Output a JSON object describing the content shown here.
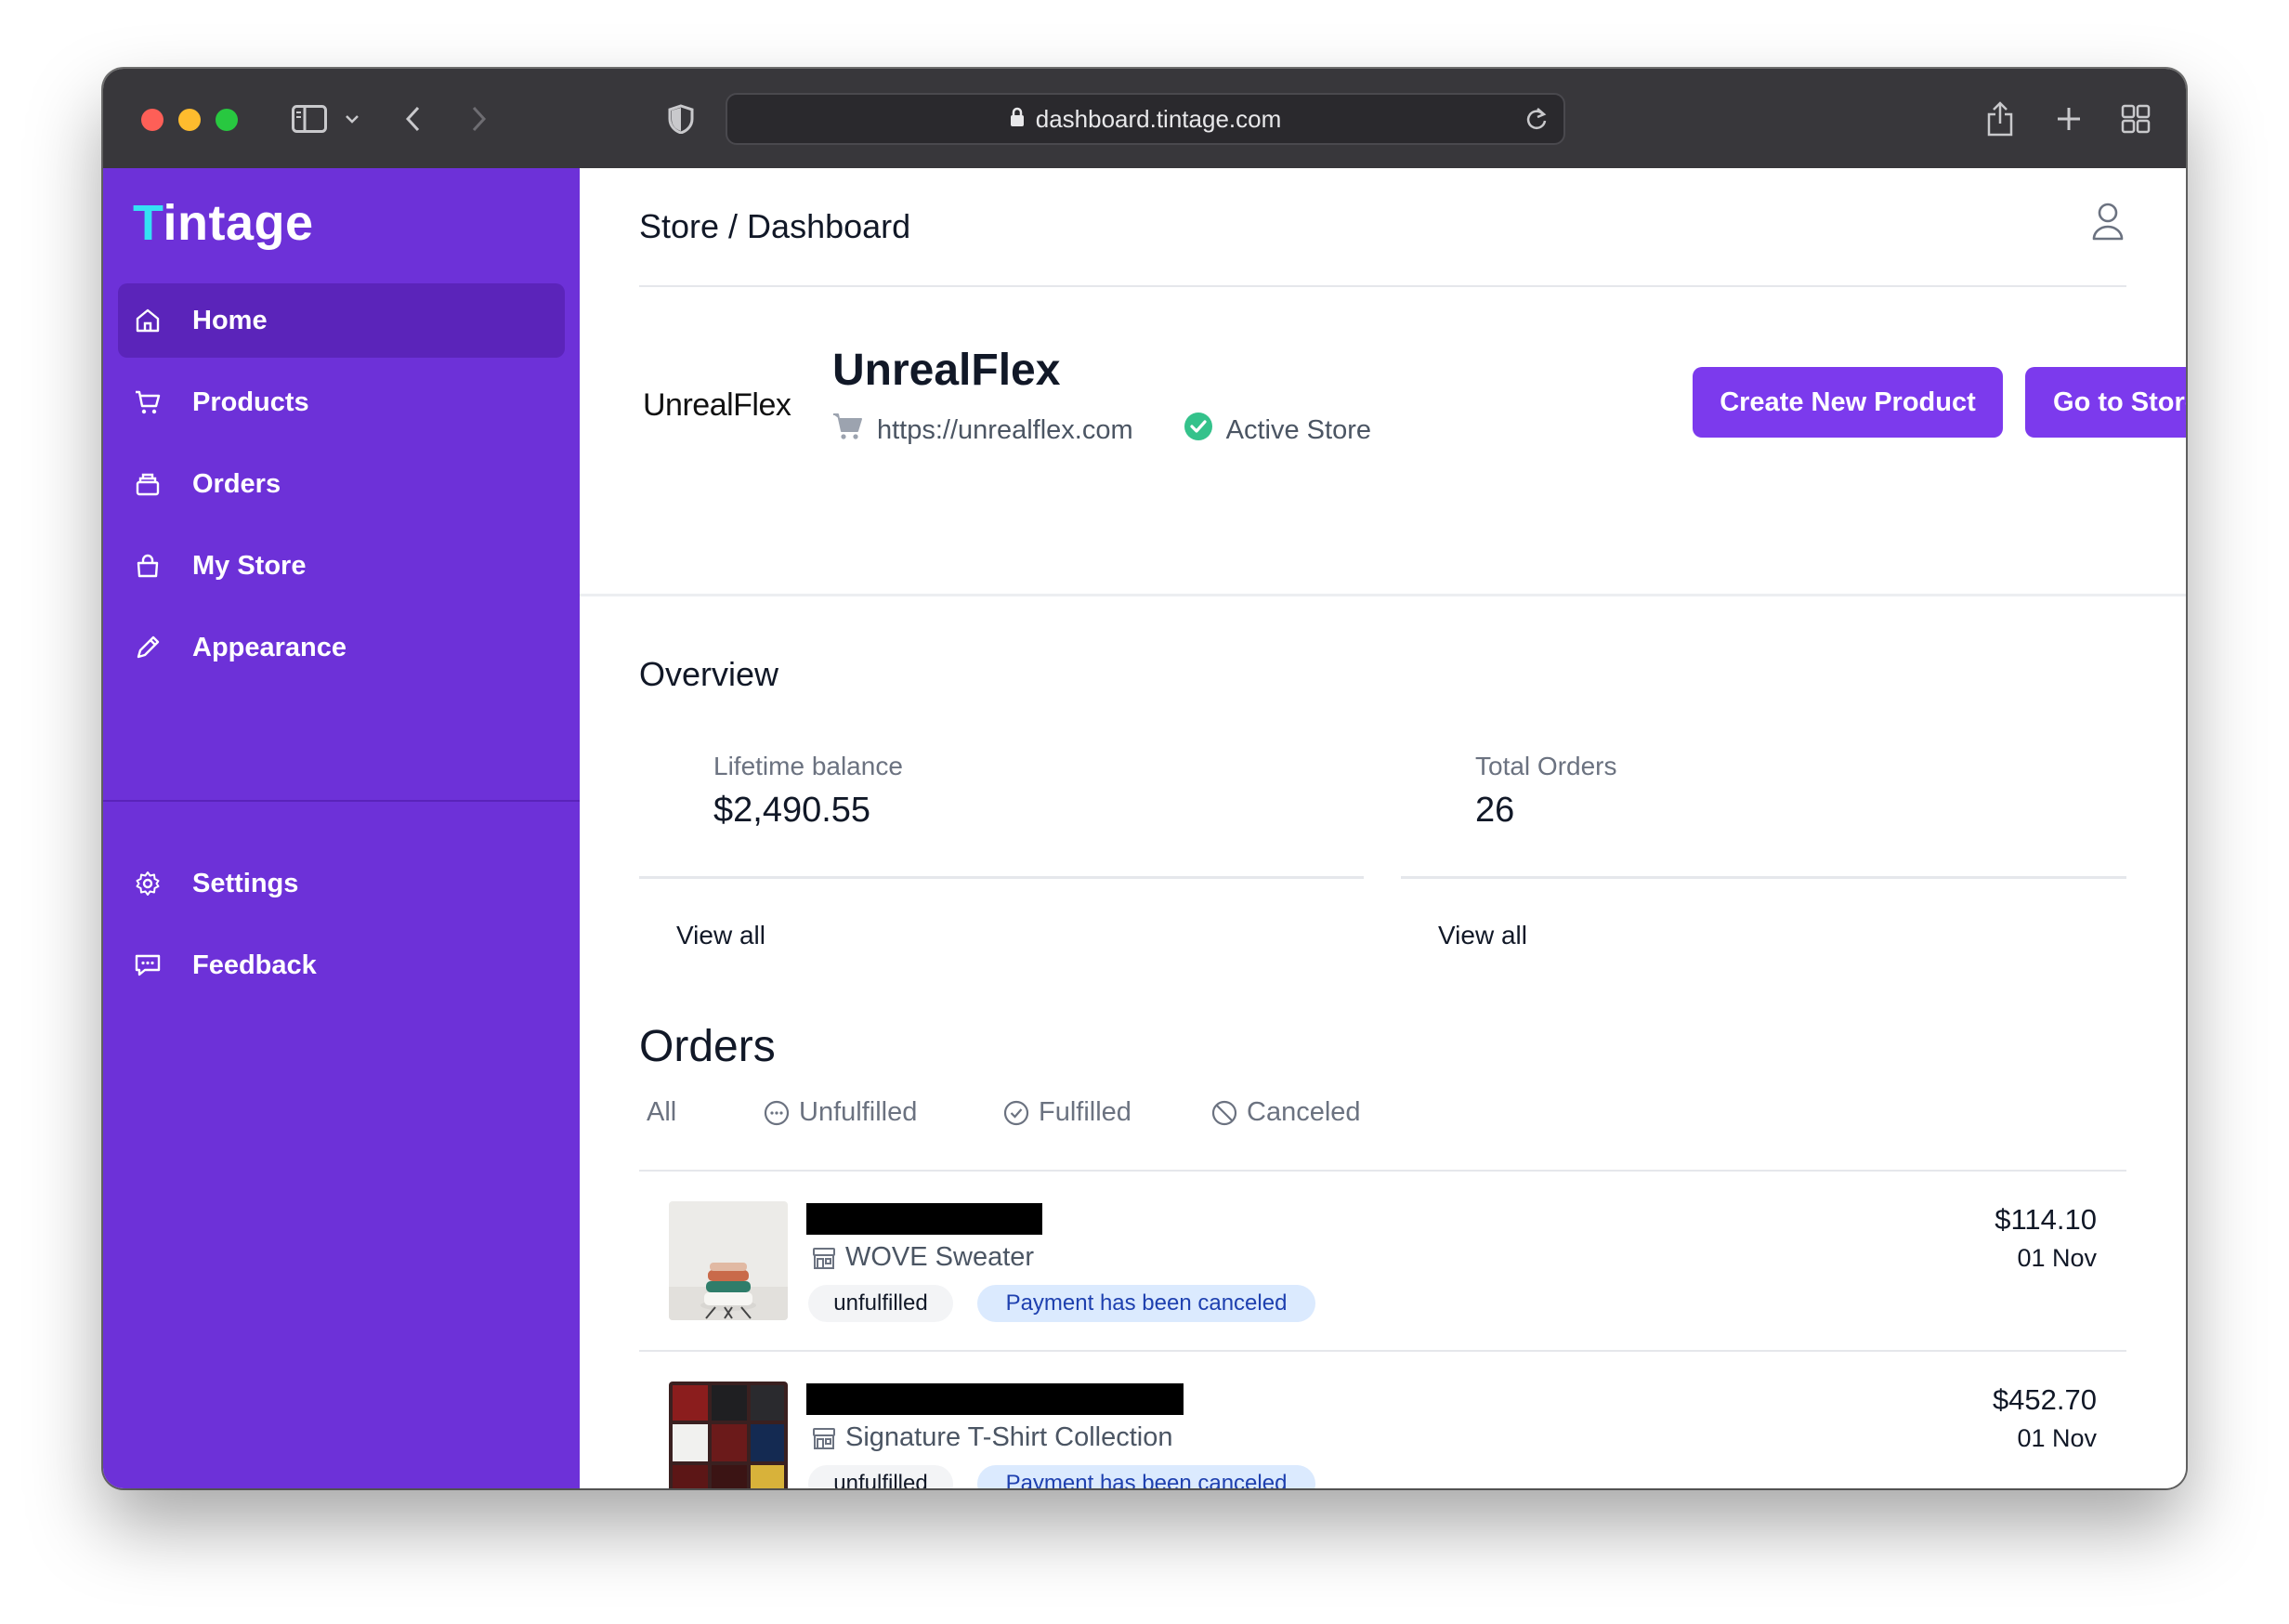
{
  "browser": {
    "url": "dashboard.tintage.com"
  },
  "sidebar": {
    "logo_first": "T",
    "logo_rest": "intage",
    "items": [
      {
        "label": "Home",
        "icon": "home-icon",
        "active": true
      },
      {
        "label": "Products",
        "icon": "cart-icon"
      },
      {
        "label": "Orders",
        "icon": "inbox-icon"
      },
      {
        "label": "My Store",
        "icon": "bag-icon"
      },
      {
        "label": "Appearance",
        "icon": "pencil-icon"
      }
    ],
    "bottom_items": [
      {
        "label": "Settings",
        "icon": "gear-icon"
      },
      {
        "label": "Feedback",
        "icon": "chat-icon"
      }
    ]
  },
  "header": {
    "breadcrumb": "Store / Dashboard"
  },
  "store": {
    "logo_text": "UnrealFlex",
    "name": "UnrealFlex",
    "url": "https://unrealflex.com",
    "status": "Active Store",
    "create_button": "Create New Product",
    "store_button": "Go to Store"
  },
  "overview": {
    "title": "Overview",
    "stats": [
      {
        "label": "Lifetime balance",
        "value": "$2,490.55",
        "link": "View all"
      },
      {
        "label": "Total Orders",
        "value": "26",
        "link": "View all"
      }
    ]
  },
  "orders": {
    "title": "Orders",
    "tabs": [
      {
        "label": "All"
      },
      {
        "label": "Unfulfilled",
        "icon": "dots-circle-icon"
      },
      {
        "label": "Fulfilled",
        "icon": "check-circle-icon"
      },
      {
        "label": "Canceled",
        "icon": "ban-icon"
      }
    ],
    "rows": [
      {
        "product": "WOVE Sweater",
        "fulfillment": "unfulfilled",
        "payment": "Payment has been canceled",
        "price": "$114.10",
        "date": "01 Nov"
      },
      {
        "product": "Signature T-Shirt Collection",
        "fulfillment": "unfulfilled",
        "payment": "Payment has been canceled",
        "price": "$452.70",
        "date": "01 Nov"
      }
    ]
  },
  "colors": {
    "sidebar": "#6d31d8",
    "sidebar_active": "#5b24ba",
    "accent": "#7c3aed",
    "logo_accent": "#34e1f4",
    "status_ok": "#34c28b"
  }
}
